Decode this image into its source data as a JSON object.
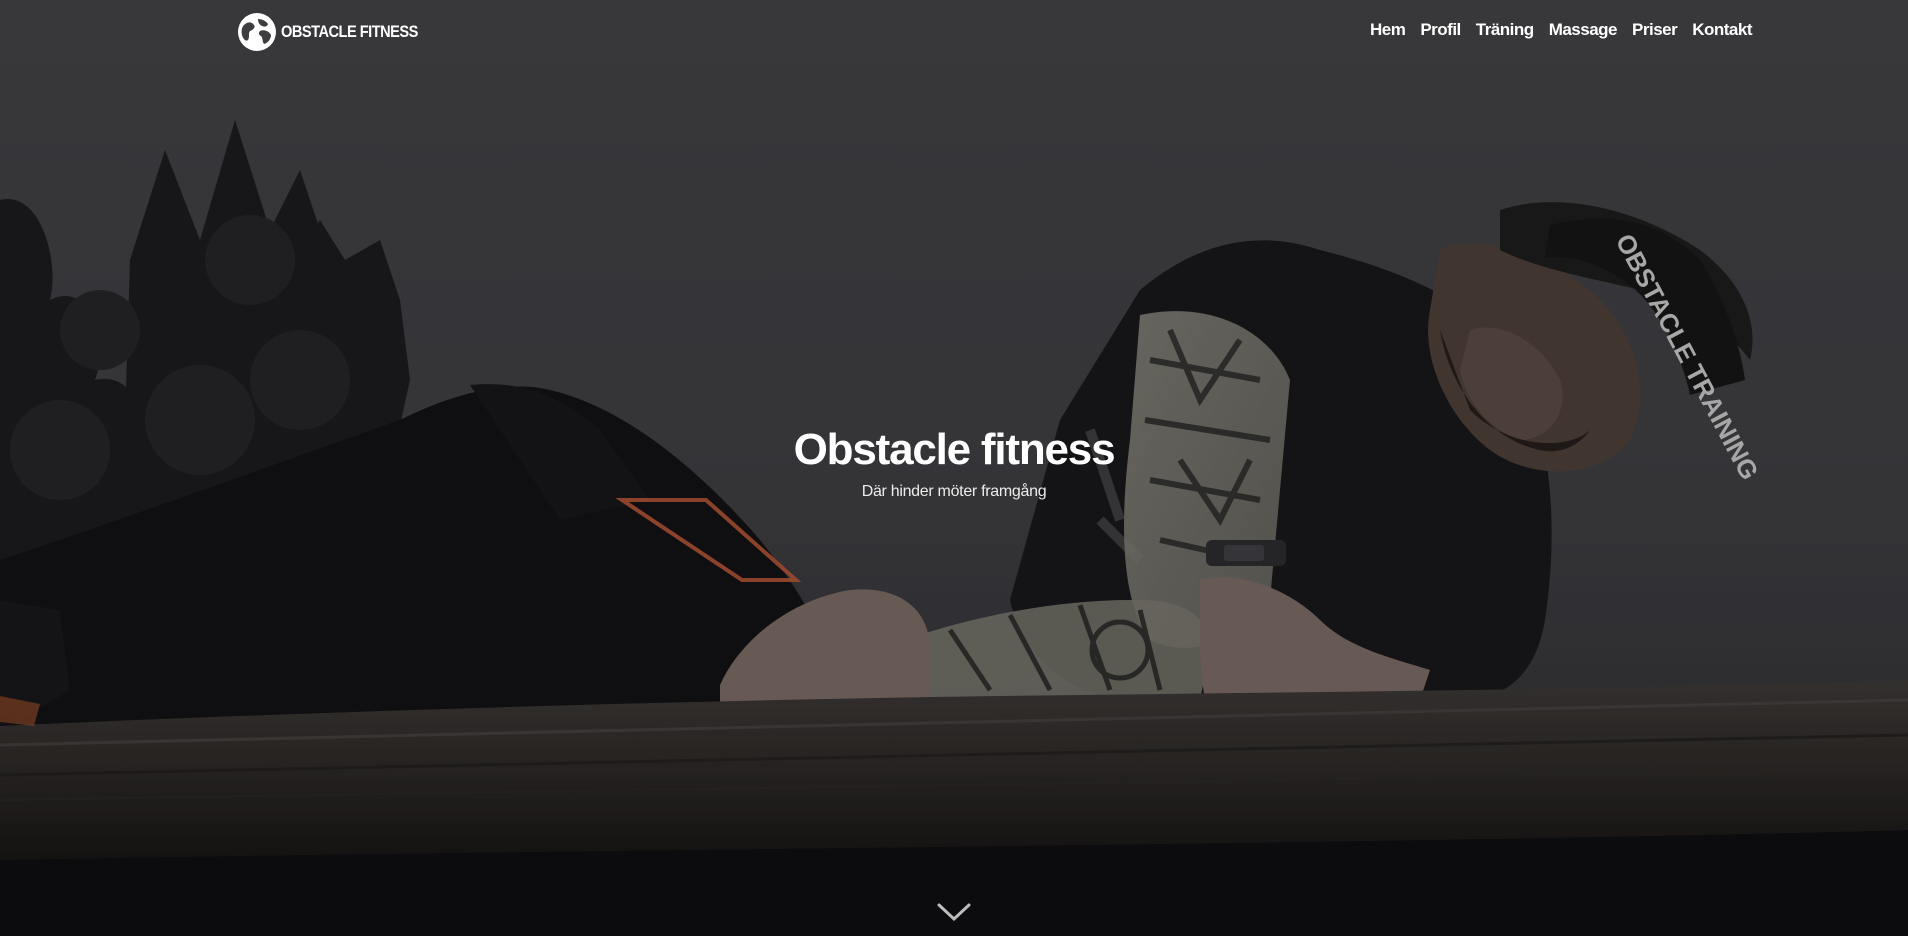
{
  "brand": {
    "name": "OBSTACLE FITNESS",
    "icon": "globe-icon"
  },
  "nav": {
    "items": [
      {
        "label": "Hem"
      },
      {
        "label": "Profil"
      },
      {
        "label": "Träning"
      },
      {
        "label": "Massage"
      },
      {
        "label": "Priser"
      },
      {
        "label": "Kontakt"
      }
    ]
  },
  "hero": {
    "title": "Obstacle fitness",
    "subtitle": "Där hinder möter framgång",
    "headband_text": "OBSTACLE TRAINING",
    "scroll_icon": "chevron-down-icon"
  },
  "colors": {
    "text": "#ffffff",
    "overlay": "#3f3f42",
    "accent_stripe": "#e0623a"
  }
}
